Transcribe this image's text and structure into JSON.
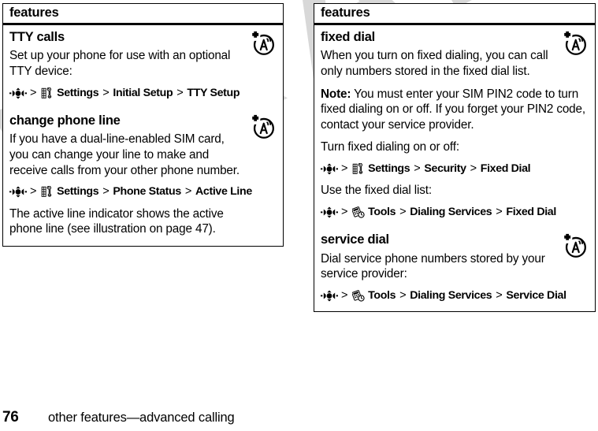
{
  "document": {
    "watermark": "DRAFT",
    "footer": {
      "page_number": "76",
      "title": "other features—advanced calling"
    }
  },
  "columns": [
    {
      "id": "left",
      "header": "features",
      "rows": [
        {
          "title": "TTY calls",
          "icon": "network-roam-icon",
          "blocks": [
            {
              "type": "para",
              "text": "Set up your phone for use with an optional TTY device:"
            },
            {
              "type": "menu_path",
              "nav_icon": "nav-key-icon",
              "segments": [
                {
                  "icon": "settings-tools-icon",
                  "label": "Settings"
                },
                {
                  "icon": null,
                  "label": "Initial Setup"
                },
                {
                  "icon": null,
                  "label": "TTY Setup"
                }
              ]
            }
          ]
        },
        {
          "title": "change phone line",
          "icon": "network-roam-icon",
          "blocks": [
            {
              "type": "para",
              "text": "If you have a dual-line-enabled SIM card, you can change your line to make and receive calls from your other phone number."
            },
            {
              "type": "menu_path",
              "nav_icon": "nav-key-icon",
              "segments": [
                {
                  "icon": "settings-tools-icon",
                  "label": "Settings"
                },
                {
                  "icon": null,
                  "label": "Phone Status"
                },
                {
                  "icon": null,
                  "label": "Active Line"
                }
              ]
            },
            {
              "type": "para",
              "text": "The active line indicator shows the active phone line (see illustration on page 47)."
            }
          ]
        }
      ]
    },
    {
      "id": "right",
      "header": "features",
      "rows": [
        {
          "title": "fixed dial",
          "icon": "network-roam-icon",
          "blocks": [
            {
              "type": "para",
              "text": "When you turn on fixed dialing, you can call only numbers stored in the fixed dial list."
            },
            {
              "type": "para_note",
              "bold_lead": "Note:",
              "text": " You must enter your SIM PIN2 code to turn fixed dialing on or off. If you forget your PIN2 code, contact your service provider."
            },
            {
              "type": "para",
              "text": "Turn fixed dialing on or off:"
            },
            {
              "type": "menu_path",
              "nav_icon": "nav-key-icon",
              "segments": [
                {
                  "icon": "settings-tools-icon",
                  "label": "Settings"
                },
                {
                  "icon": null,
                  "label": "Security"
                },
                {
                  "icon": null,
                  "label": "Fixed Dial"
                }
              ]
            },
            {
              "type": "para",
              "text": "Use the fixed dial list:"
            },
            {
              "type": "menu_path",
              "nav_icon": "nav-key-icon",
              "segments": [
                {
                  "icon": "tools-icon",
                  "label": "Tools"
                },
                {
                  "icon": null,
                  "label": "Dialing Services"
                },
                {
                  "icon": null,
                  "label": "Fixed Dial"
                }
              ]
            }
          ]
        },
        {
          "title": "service dial",
          "icon": "network-roam-icon",
          "blocks": [
            {
              "type": "para",
              "text": "Dial service phone numbers stored by your service provider:"
            },
            {
              "type": "menu_path",
              "nav_icon": "nav-key-icon",
              "segments": [
                {
                  "icon": "tools-icon",
                  "label": "Tools"
                },
                {
                  "icon": null,
                  "label": "Dialing Services"
                },
                {
                  "icon": null,
                  "label": "Service Dial"
                }
              ]
            }
          ]
        }
      ]
    }
  ],
  "symbols": {
    "menu_separator": ">"
  },
  "colors": {
    "text": "#000000",
    "background": "#ffffff",
    "watermark": "#d8d8d8",
    "rule": "#000000"
  }
}
